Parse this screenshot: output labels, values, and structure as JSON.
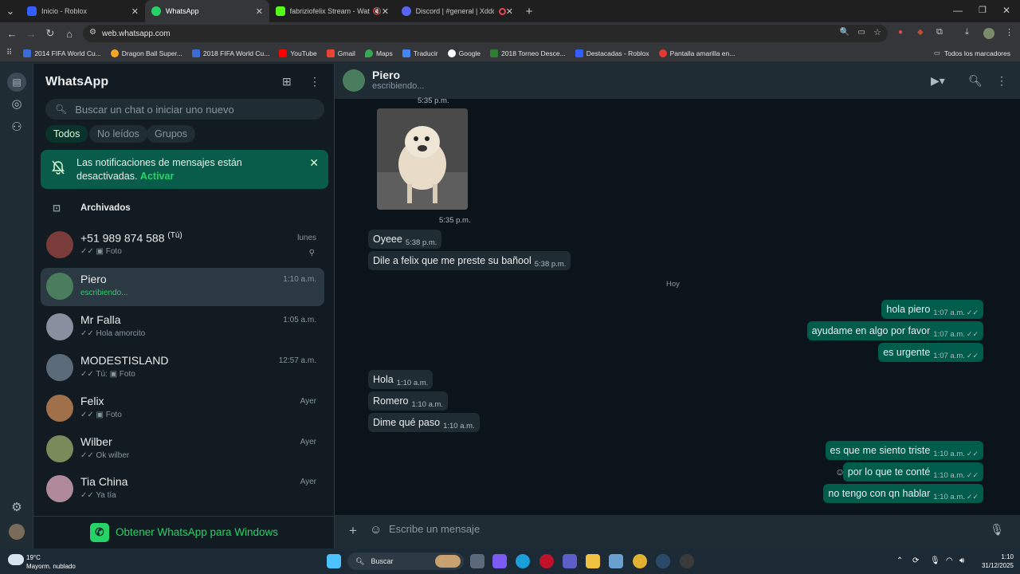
{
  "browser": {
    "tabs": [
      {
        "title": "Inicio - Roblox",
        "color": "#335fff"
      },
      {
        "title": "WhatsApp",
        "color": "#25d366",
        "active": true
      },
      {
        "title": "fabriziofelix Stream - Watch",
        "color": "#53fc18"
      },
      {
        "title": "Discord | #general | Xddd",
        "color": "#5865f2"
      }
    ],
    "url": "web.whatsapp.com",
    "bookmarks": [
      {
        "label": "2014 FIFA World Cu...",
        "color": "#3b6bd6"
      },
      {
        "label": "Dragon Ball Super...",
        "color": "#f5a623"
      },
      {
        "label": "2018 FIFA World Cu...",
        "color": "#3b6bd6"
      },
      {
        "label": "YouTube",
        "color": "#ff0000"
      },
      {
        "label": "Gmail",
        "color": "#ea4335"
      },
      {
        "label": "Maps",
        "color": "#34a853"
      },
      {
        "label": "Traducir",
        "color": "#4285f4"
      },
      {
        "label": "Google",
        "color": "#4285f4"
      },
      {
        "label": "2018 Torneo Desce...",
        "color": "#2e7d32"
      },
      {
        "label": "Destacadas - Roblox",
        "color": "#335fff"
      },
      {
        "label": "Pantalla amarilla en...",
        "color": "#e53935"
      }
    ],
    "all_bookmarks": "Todos los marcadores"
  },
  "sidebar": {
    "title": "WhatsApp",
    "search_placeholder": "Buscar un chat o iniciar uno nuevo",
    "filters": [
      "Todos",
      "No leídos",
      "Grupos"
    ],
    "notification": {
      "text": "Las notificaciones de mensajes están desactivadas.",
      "action": "Activar"
    },
    "archived": "Archivados",
    "chats": [
      {
        "name": "+51 989 874 588",
        "suffix": "(Tú)",
        "time": "lunes",
        "preview": "✓✓ ▣ Foto",
        "avatar_color": "#7a3b3b",
        "pinned": true
      },
      {
        "name": "Piero",
        "time": "1:10 a.m.",
        "preview": "escribiendo...",
        "avatar_color": "#4a7c5e",
        "typing": true,
        "selected": true
      },
      {
        "name": "Mr Falla",
        "time": "1:05 a.m.",
        "preview": "✓✓ Hola amorcito",
        "avatar_color": "#8a8fa0"
      },
      {
        "name": "MODESTISLAND",
        "time": "12:57 a.m.",
        "preview": "✓✓ Tú: ▣ Foto",
        "avatar_color": "#5b6b7a"
      },
      {
        "name": "Felix",
        "time": "Ayer",
        "preview": "✓✓ ▣ Foto",
        "avatar_color": "#a0704a"
      },
      {
        "name": "Wilber",
        "time": "Ayer",
        "preview": "✓✓ Ok wilber",
        "avatar_color": "#7a8a5a"
      },
      {
        "name": "Tia China",
        "time": "Ayer",
        "preview": "✓✓ Ya tía",
        "avatar_color": "#b08a9a"
      }
    ],
    "get_app": "Obtener WhatsApp para Windows"
  },
  "conversation": {
    "contact_name": "Piero",
    "contact_status": "escribiendo...",
    "top_time": "5:35 p.m.",
    "image_time": "5:35 p.m.",
    "day_divider": "Hoy",
    "messages": [
      {
        "text": "Oyeee",
        "time": "5:38 p.m.",
        "dir": "in"
      },
      {
        "text": "Dile a felix que me preste su bañool",
        "time": "5:38 p.m.",
        "dir": "in"
      },
      {
        "text": "hola piero",
        "time": "1:07 a.m.",
        "dir": "out"
      },
      {
        "text": "ayudame en algo por favor",
        "time": "1:07 a.m.",
        "dir": "out"
      },
      {
        "text": "es urgente",
        "time": "1:07 a.m.",
        "dir": "out"
      },
      {
        "text": "Hola",
        "time": "1:10 a.m.",
        "dir": "in"
      },
      {
        "text": "Romero",
        "time": "1:10 a.m.",
        "dir": "in"
      },
      {
        "text": "Dime qué paso",
        "time": "1:10 a.m.",
        "dir": "in"
      },
      {
        "text": "es que me siento triste",
        "time": "1:10 a.m.",
        "dir": "out"
      },
      {
        "text": "por lo que te conté",
        "time": "1:10 a.m.",
        "dir": "out"
      },
      {
        "text": "no tengo con qn hablar",
        "time": "1:10 a.m.",
        "dir": "out"
      }
    ],
    "composer_placeholder": "Escribe un mensaje"
  },
  "taskbar": {
    "temperature": "19°C",
    "condition": "Mayorm. nublado",
    "search": "Buscar",
    "time": "1:10",
    "date": "31/12/2025"
  },
  "colors": {
    "accent": "#25d366",
    "outgoing_bubble": "#005c4b",
    "incoming_bubble": "#202c33",
    "panel": "#111b21"
  }
}
